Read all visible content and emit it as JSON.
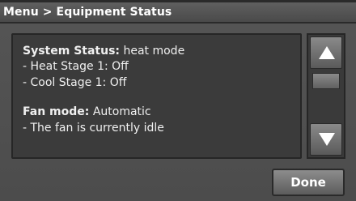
{
  "header": {
    "title": "Menu > Equipment Status"
  },
  "status": {
    "system_label": "System Status:",
    "system_value": "heat mode",
    "heat_stage": "- Heat Stage 1: Off",
    "cool_stage": "- Cool Stage 1: Off",
    "fan_label": "Fan mode:",
    "fan_value": "Automatic",
    "fan_state": "- The fan is currently idle"
  },
  "scroll": {
    "up_icon": "triangle-up-icon",
    "down_icon": "triangle-down-icon"
  },
  "buttons": {
    "done_label": "Done"
  },
  "colors": {
    "background": "#4c4c4c",
    "panel": "#3b3b3b",
    "text": "#f0f0f0",
    "button": "#7a7a7a"
  }
}
